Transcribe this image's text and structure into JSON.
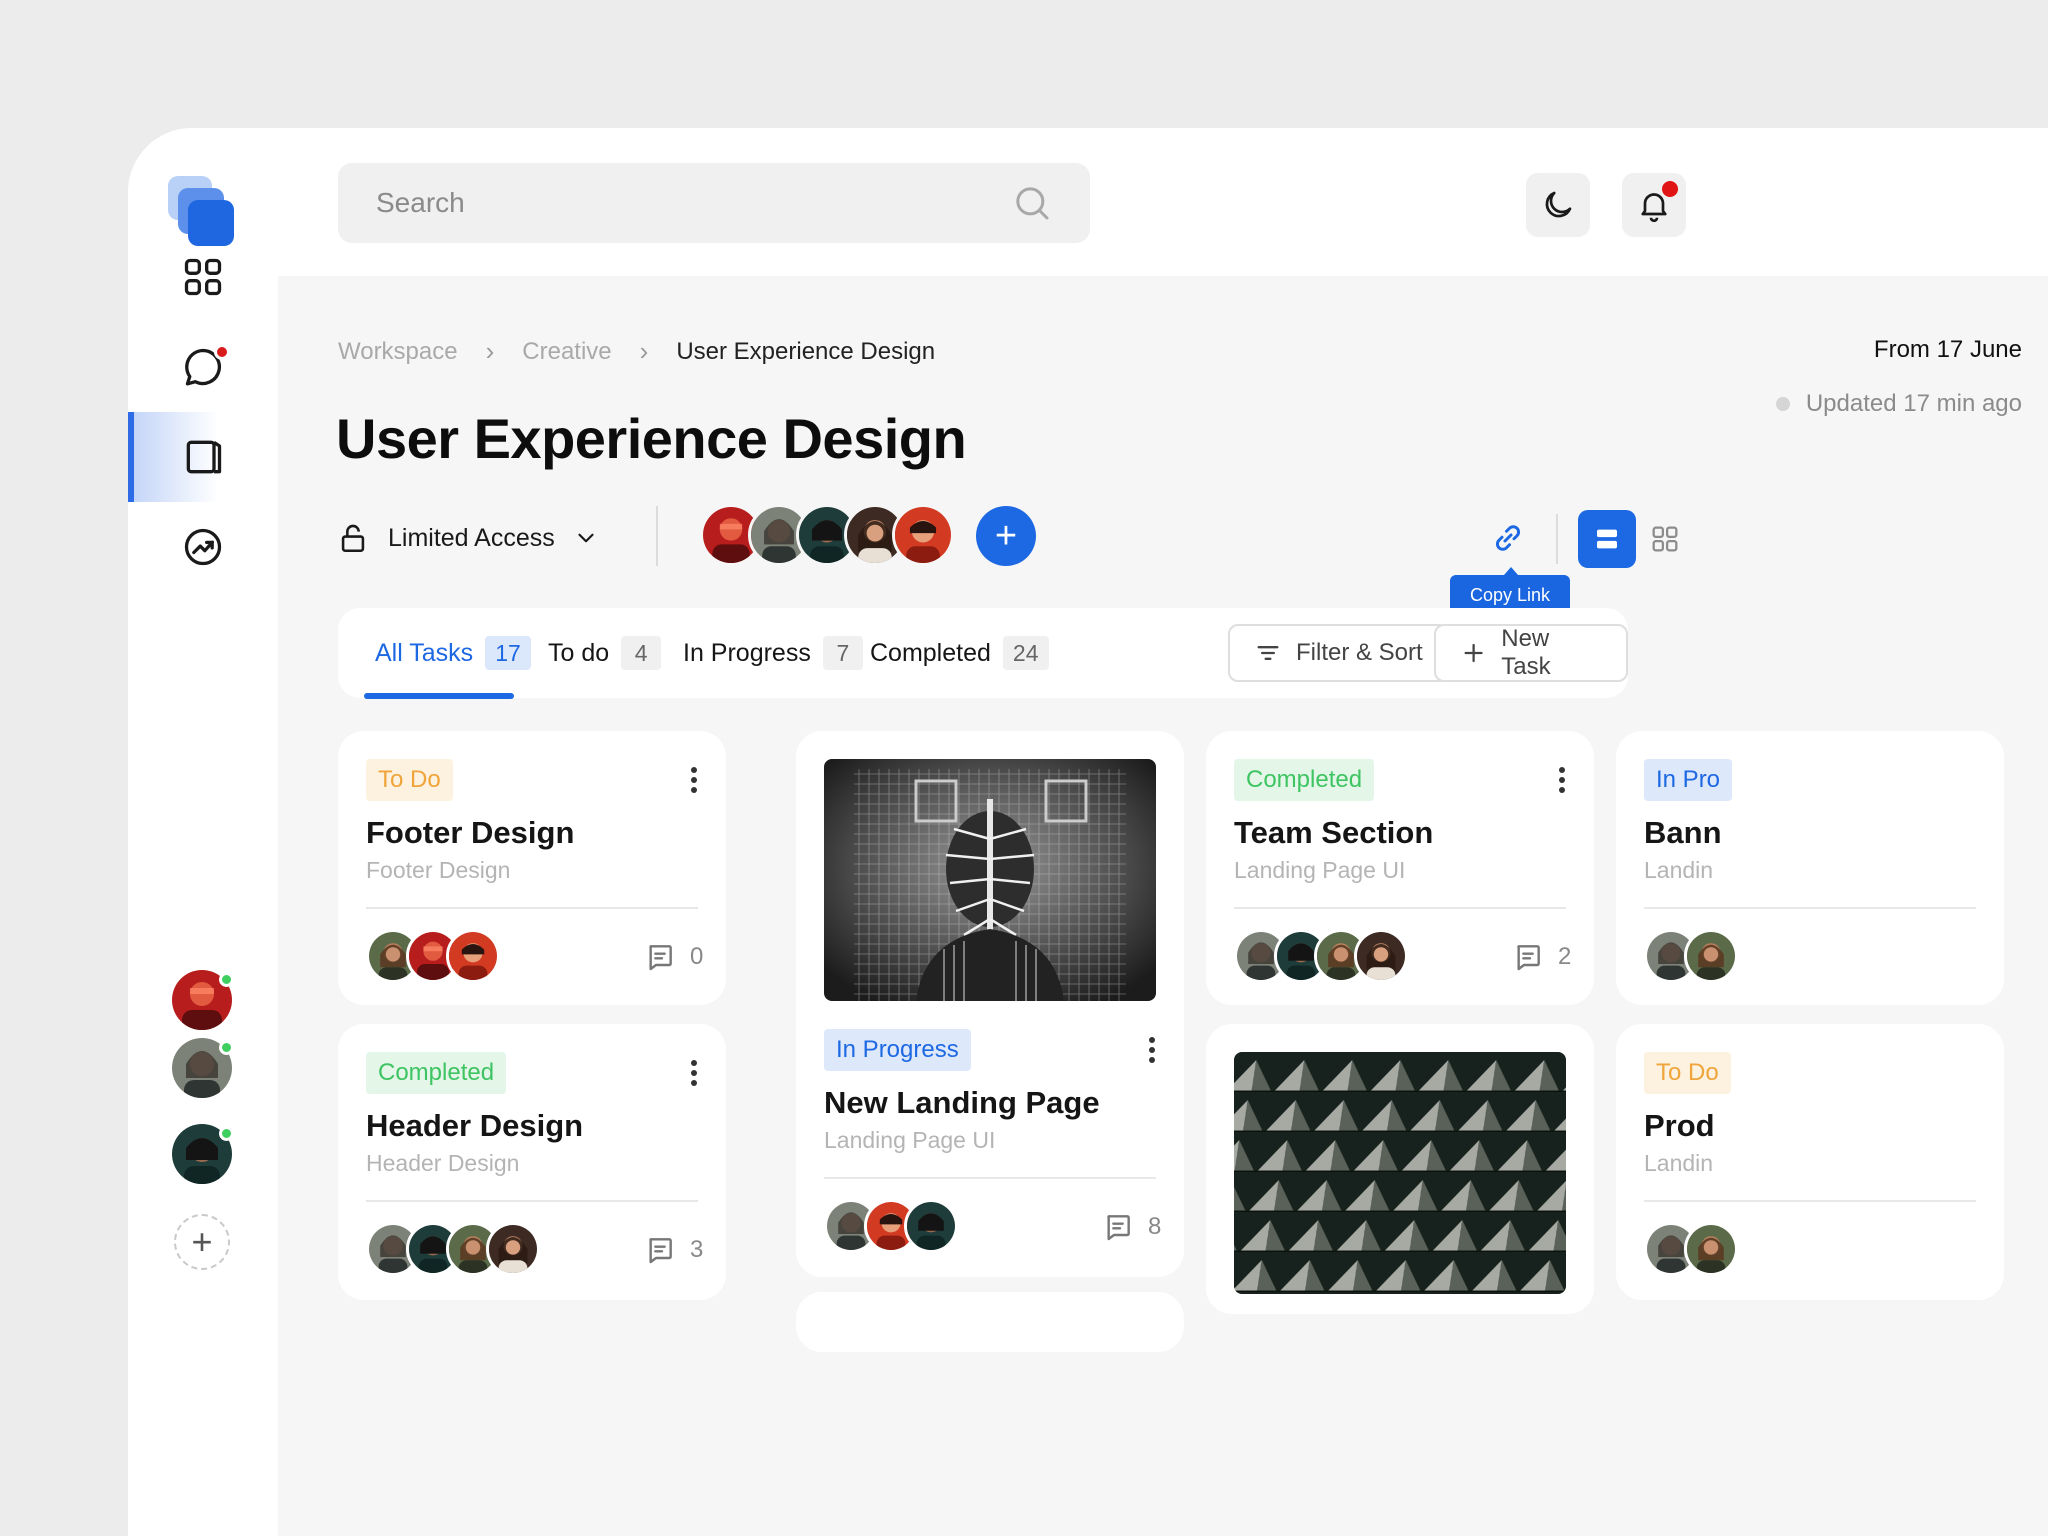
{
  "search": {
    "placeholder": "Search"
  },
  "breadcrumb": {
    "items": [
      "Workspace",
      "Creative",
      "User Experience Design"
    ]
  },
  "page": {
    "title": "User Experience Design",
    "from_date": "From 17 June",
    "updated": "Updated 17 min ago"
  },
  "access": {
    "label": "Limited Access"
  },
  "tooltip": {
    "copy_link": "Copy Link"
  },
  "tabs": [
    {
      "label": "All Tasks",
      "count": "17"
    },
    {
      "label": "To do",
      "count": "4"
    },
    {
      "label": "In Progress",
      "count": "7"
    },
    {
      "label": "Completed",
      "count": "24"
    }
  ],
  "actions": {
    "filter": "Filter & Sort",
    "new_task": "New Task"
  },
  "cards": {
    "footer": {
      "status": "To Do",
      "title": "Footer Design",
      "subtitle": "Footer Design",
      "comments": "0"
    },
    "header": {
      "status": "Completed",
      "title": "Header Design",
      "subtitle": "Header Design",
      "comments": "3"
    },
    "landing": {
      "status": "In Progress",
      "title": "New Landing Page",
      "subtitle": "Landing Page UI",
      "comments": "8"
    },
    "team": {
      "status": "Completed",
      "title": "Team Section",
      "subtitle": "Landing Page UI",
      "comments": "2"
    },
    "banner": {
      "status": "In Pro",
      "title": "Bann",
      "subtitle": "Landin"
    },
    "product": {
      "status": "To Do",
      "title": "Prod",
      "subtitle": "Landin"
    }
  },
  "colors": {
    "accent": "#1d68e3",
    "todo": "#f0a53a",
    "completed": "#3ec462",
    "notification": "#e01414"
  }
}
